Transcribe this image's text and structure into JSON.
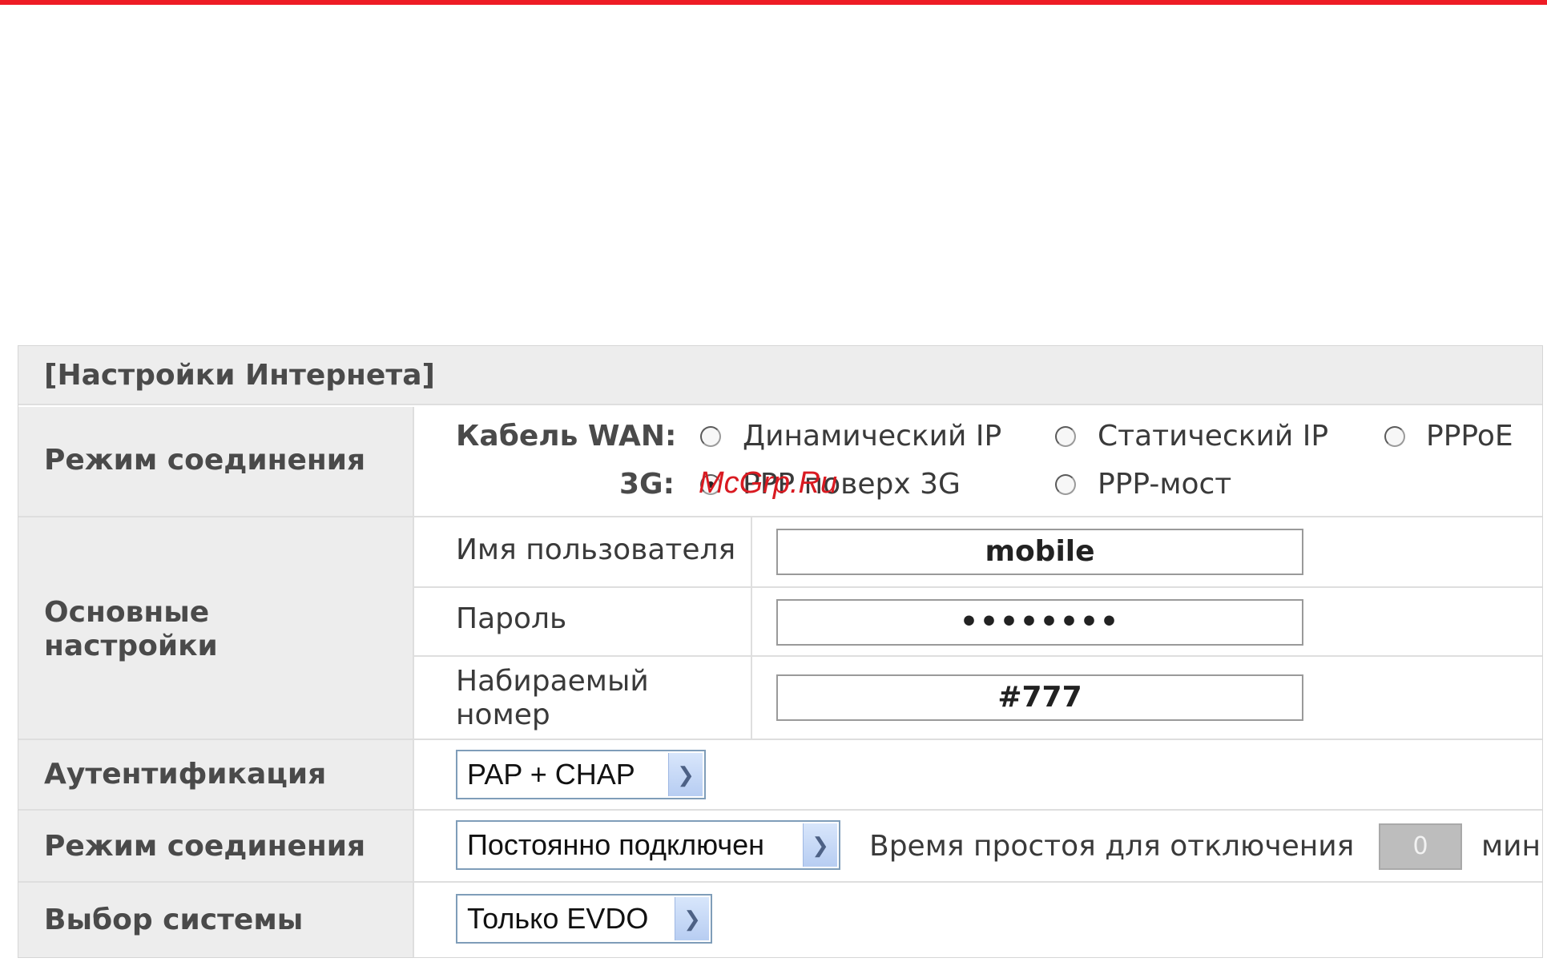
{
  "section_title": "[Настройки Интернета]",
  "connection_mode": {
    "label": "Режим соединения",
    "cable_wan_label": "Кабель WAN:",
    "cable_options": [
      "Динамический IP",
      "Статический IP",
      "PPPoE"
    ],
    "g3_label": "3G:",
    "g3_options": [
      "PPP поверх 3G",
      "PPP-мост"
    ],
    "selected": "PPP поверх 3G"
  },
  "basic_settings": {
    "label_line1": "Основные",
    "label_line2": "настройки",
    "username_label": "Имя пользователя",
    "username_value": "mobile",
    "password_label": "Пароль",
    "password_value": "••••••••",
    "dial_label_line1": "Набираемый",
    "dial_label_line2": "номер",
    "dial_value": "#777"
  },
  "authentication": {
    "label": "Аутентификация",
    "value": "PAP + CHAP"
  },
  "connection_type": {
    "label": "Режим соединения",
    "value": "Постоянно подключен",
    "idle_label": "Время простоя для отключения",
    "idle_value": "0",
    "idle_unit": "мин"
  },
  "system_select": {
    "label": "Выбор системы",
    "value": "Только EVDO"
  },
  "watermark": "McGrp.Ru",
  "colors": {
    "accent": "#ee1c25",
    "label_bg": "#ededed",
    "border": "#dedede"
  }
}
